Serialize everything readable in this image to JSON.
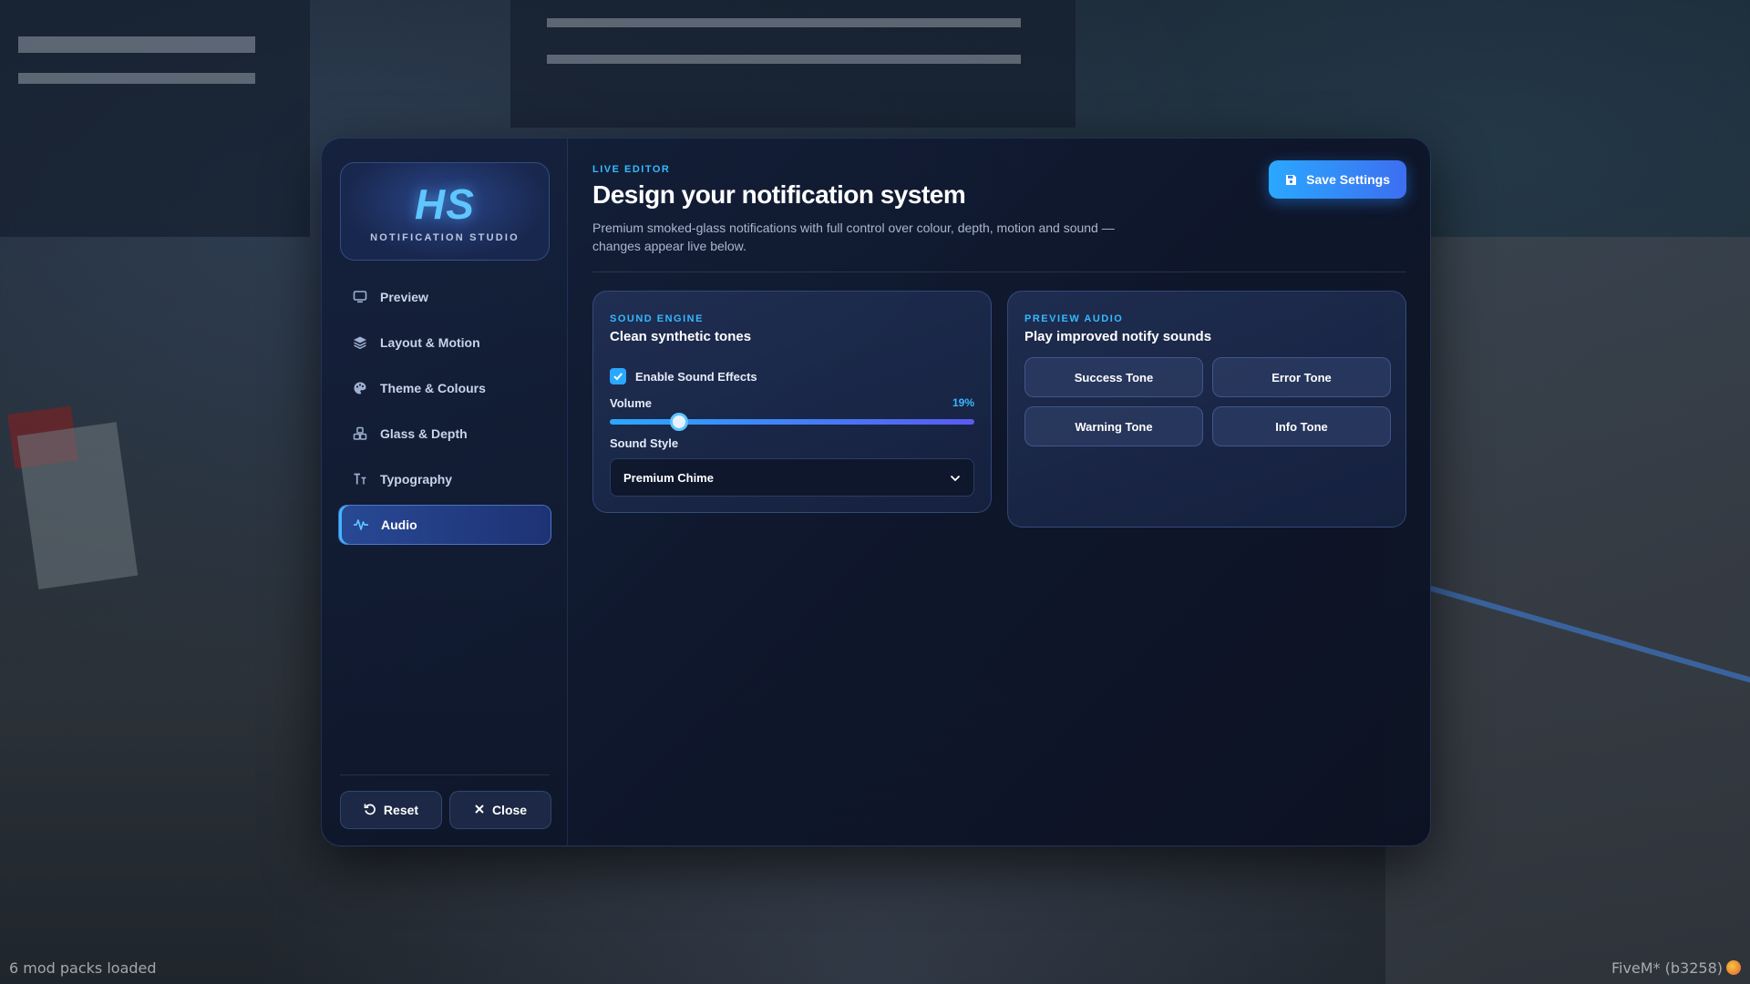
{
  "overlay": {
    "left_text": "6 mod packs loaded",
    "right_text": "FiveM* (b3258)"
  },
  "sidebar": {
    "logo_mark": "HS",
    "logo_sub": "NOTIFICATION STUDIO",
    "items": [
      {
        "label": "Preview",
        "icon": "monitor-icon",
        "active": false
      },
      {
        "label": "Layout & Motion",
        "icon": "layers-icon",
        "active": false
      },
      {
        "label": "Theme & Colours",
        "icon": "palette-icon",
        "active": false
      },
      {
        "label": "Glass & Depth",
        "icon": "boxes-icon",
        "active": false
      },
      {
        "label": "Typography",
        "icon": "text-size-icon",
        "active": false
      },
      {
        "label": "Audio",
        "icon": "waveform-icon",
        "active": true
      }
    ],
    "reset_label": "Reset",
    "close_label": "Close"
  },
  "header": {
    "eyebrow": "LIVE EDITOR",
    "title": "Design your notification system",
    "description": "Premium smoked-glass notifications with full control over colour, depth, motion and sound — changes appear live below.",
    "save_label": "Save Settings"
  },
  "sound_engine": {
    "eyebrow": "SOUND ENGINE",
    "title": "Clean synthetic tones",
    "enable_label": "Enable Sound Effects",
    "enabled": true,
    "volume_label": "Volume",
    "volume_value": "19%",
    "volume_fraction": 0.19,
    "style_label": "Sound Style",
    "style_value": "Premium Chime"
  },
  "preview_audio": {
    "eyebrow": "PREVIEW AUDIO",
    "title": "Play improved notify sounds",
    "tones": [
      "Success Tone",
      "Error Tone",
      "Warning Tone",
      "Info Tone"
    ]
  },
  "colors": {
    "accent": "#35b9ff",
    "save_gradient_start": "#2aa8ff",
    "save_gradient_end": "#3d6ef0"
  }
}
